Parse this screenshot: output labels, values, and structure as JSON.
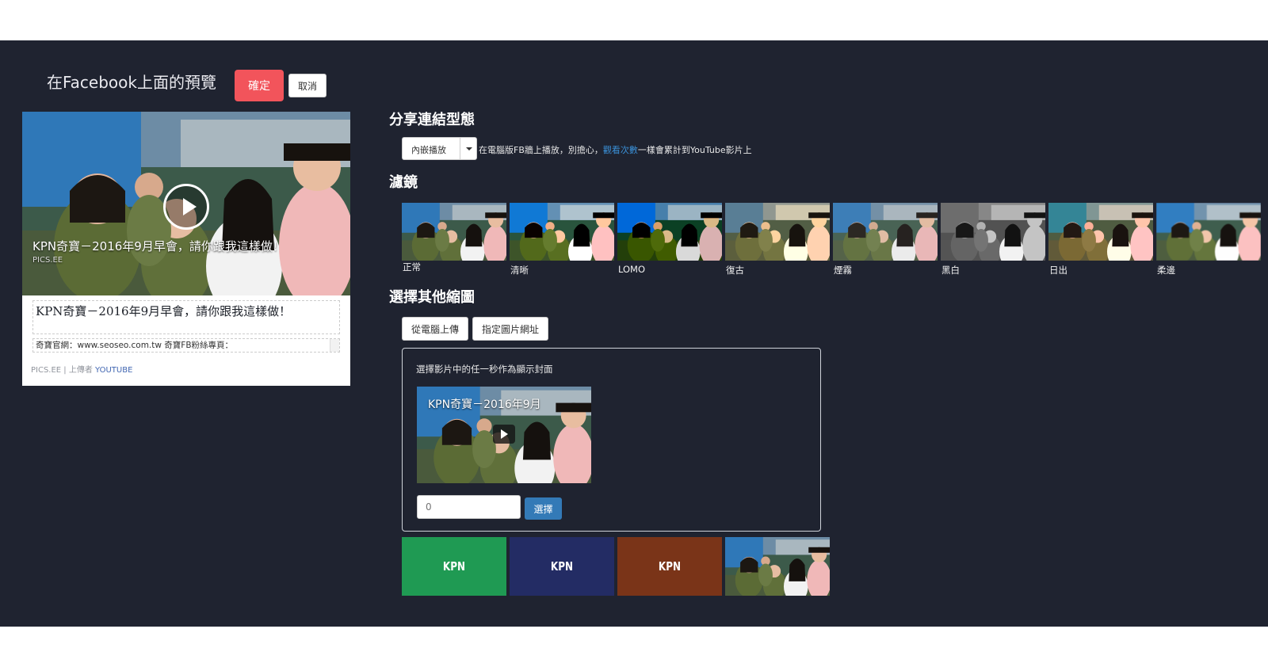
{
  "header": {
    "title": "在Facebook上面的預覽",
    "confirm_label": "確定",
    "cancel_label": "取消"
  },
  "preview": {
    "video_title": "KPN奇寶－2016年9月早會，請你跟我這樣做！",
    "video_source": "PICS.EE",
    "title": "KPN奇寶－2016年9月早會，請你跟我這樣做！",
    "description": "奇寶官網：www.seoseo.com.tw 奇寶FB粉絲專頁：",
    "meta_prefix": "PICS.EE | 上傳者",
    "meta_link": "YOUTUBE"
  },
  "share_type": {
    "heading": "分享連結型態",
    "selected": "內嵌播放",
    "note_before": "在電腦版FB牆上播放，別擔心，",
    "note_link": "觀看次數",
    "note_after": "一樣會累計到YouTube影片上"
  },
  "filters": {
    "heading": "濾鏡",
    "items": [
      {
        "label": "正常"
      },
      {
        "label": "清晰"
      },
      {
        "label": "LOMO"
      },
      {
        "label": "復古"
      },
      {
        "label": "煙霧"
      },
      {
        "label": "黑白"
      },
      {
        "label": "日出"
      },
      {
        "label": "柔邊"
      }
    ]
  },
  "thumbnail": {
    "heading": "選擇其他縮圖",
    "upload_label": "從電腦上傳",
    "url_label": "指定圖片網址",
    "picker_label": "選擇影片中的任一秒作為顯示封面",
    "mini_title": "KPN奇寶－2016年9月",
    "seconds_value": "0",
    "select_label": "選擇"
  },
  "covers": [
    {
      "text": "KPN",
      "color": "#1f9a53"
    },
    {
      "text": "KPN",
      "color": "#232c64"
    },
    {
      "text": "KPN",
      "color": "#7a3418"
    }
  ]
}
